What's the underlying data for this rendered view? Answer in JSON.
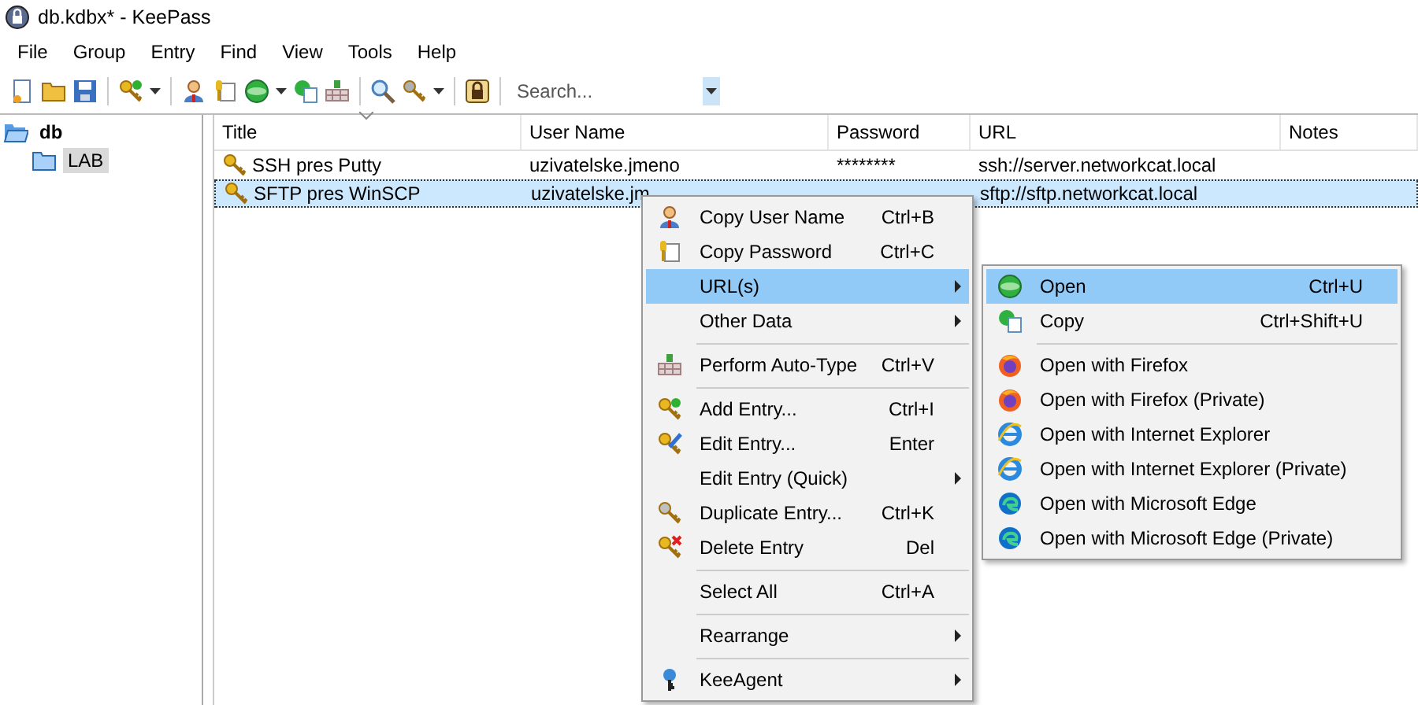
{
  "window": {
    "title": "db.kdbx* - KeePass"
  },
  "menu_bar": [
    "File",
    "Group",
    "Entry",
    "Find",
    "View",
    "Tools",
    "Help"
  ],
  "search": {
    "placeholder": "Search..."
  },
  "tree": [
    {
      "label": "db",
      "expanded": true,
      "selected": false,
      "children": [
        {
          "label": "LAB",
          "selected": true,
          "expanded": false
        }
      ]
    }
  ],
  "table": {
    "columns": [
      "Title",
      "User Name",
      "Password",
      "URL",
      "Notes"
    ],
    "rows": [
      {
        "title": "SSH pres Putty",
        "user_name": "uzivatelske.jmeno",
        "password": "********",
        "url": "ssh://server.networkcat.local",
        "selected": false
      },
      {
        "title": "SFTP pres WinSCP",
        "user_name": "uzivatelske.jm",
        "url": "sftp://sftp.networkcat.local",
        "selected": true
      }
    ]
  },
  "context_menu": [
    {
      "kind": "item",
      "label": "Copy User Name",
      "shortcut": "Ctrl+B",
      "submenu": false,
      "selected": false
    },
    {
      "kind": "item",
      "label": "Copy Password",
      "shortcut": "Ctrl+C",
      "submenu": false,
      "selected": false
    },
    {
      "kind": "item",
      "label": "URL(s)",
      "submenu": true,
      "selected": true
    },
    {
      "kind": "item",
      "label": "Other Data",
      "submenu": true,
      "selected": false
    },
    {
      "kind": "separator"
    },
    {
      "kind": "item",
      "label": "Perform Auto-Type",
      "shortcut": "Ctrl+V",
      "submenu": false,
      "selected": false
    },
    {
      "kind": "separator"
    },
    {
      "kind": "item",
      "label": "Add Entry...",
      "shortcut": "Ctrl+I",
      "submenu": false,
      "selected": false
    },
    {
      "kind": "item",
      "label": "Edit Entry...",
      "shortcut": "Enter",
      "submenu": false,
      "selected": false
    },
    {
      "kind": "item",
      "label": "Edit Entry (Quick)",
      "submenu": true,
      "selected": false
    },
    {
      "kind": "item",
      "label": "Duplicate Entry...",
      "shortcut": "Ctrl+K",
      "submenu": false,
      "selected": false
    },
    {
      "kind": "item",
      "label": "Delete Entry",
      "shortcut": "Del",
      "submenu": false,
      "selected": false
    },
    {
      "kind": "separator"
    },
    {
      "kind": "item",
      "label": "Select All",
      "shortcut": "Ctrl+A",
      "submenu": false,
      "selected": false
    },
    {
      "kind": "separator"
    },
    {
      "kind": "item",
      "label": "Rearrange",
      "submenu": true,
      "selected": false
    },
    {
      "kind": "separator"
    },
    {
      "kind": "item",
      "label": "KeeAgent",
      "submenu": true,
      "selected": false
    }
  ],
  "url_submenu": [
    {
      "kind": "item",
      "label": "Open",
      "shortcut": "Ctrl+U",
      "selected": true
    },
    {
      "kind": "item",
      "label": "Copy",
      "shortcut": "Ctrl+Shift+U",
      "selected": false
    },
    {
      "kind": "separator"
    },
    {
      "kind": "item",
      "label": "Open with Firefox",
      "selected": false
    },
    {
      "kind": "item",
      "label": "Open with Firefox (Private)",
      "selected": false
    },
    {
      "kind": "item",
      "label": "Open with Internet Explorer",
      "selected": false
    },
    {
      "kind": "item",
      "label": "Open with Internet Explorer (Private)",
      "selected": false
    },
    {
      "kind": "item",
      "label": "Open with Microsoft Edge",
      "selected": false
    },
    {
      "kind": "item",
      "label": "Open with Microsoft Edge (Private)",
      "selected": false
    }
  ]
}
